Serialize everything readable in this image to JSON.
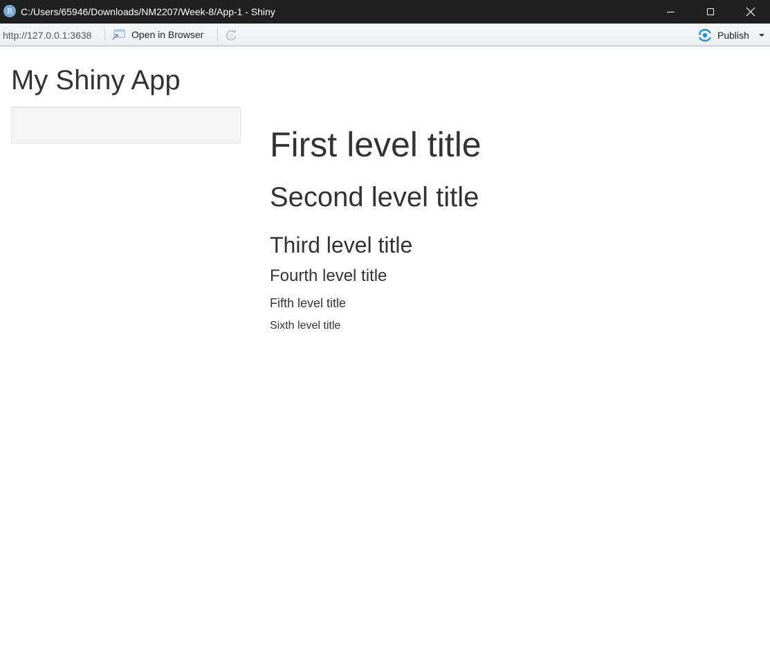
{
  "window": {
    "app_icon_letter": "R",
    "title": "C:/Users/65946/Downloads/NM2207/Week-8/App-1 - Shiny"
  },
  "toolbar": {
    "url": "http://127.0.0.1:3638",
    "open_in_browser_label": "Open in Browser",
    "publish_label": "Publish",
    "publish_icon_color": "#1a8fd6"
  },
  "app": {
    "title": "My Shiny App",
    "headings": {
      "h1": "First level title",
      "h2": "Second level title",
      "h3": "Third level title",
      "h4": "Fourth level title",
      "h5": "Fifth level title",
      "h6": "Sixth level title"
    }
  }
}
